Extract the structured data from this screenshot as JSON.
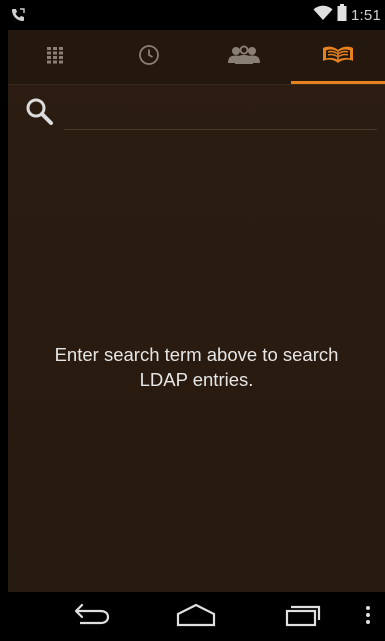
{
  "status_bar": {
    "time": "1:51",
    "left_icon": "phone-call-icon",
    "wifi_icon": "wifi-icon",
    "battery_icon": "battery-icon"
  },
  "tabs": [
    {
      "name": "tab-dialpad",
      "icon": "dialpad-icon",
      "active": false
    },
    {
      "name": "tab-recent",
      "icon": "clock-icon",
      "active": false
    },
    {
      "name": "tab-contacts",
      "icon": "contacts-icon",
      "active": false
    },
    {
      "name": "tab-ldap-directory",
      "icon": "book-icon",
      "active": true
    }
  ],
  "search": {
    "value": "",
    "placeholder": ""
  },
  "empty_state": {
    "line1": "Enter search term above to search",
    "line2": "LDAP entries."
  },
  "nav_bar": {
    "back_icon": "back-icon",
    "home_icon": "home-icon",
    "recents_icon": "recent-apps-icon",
    "menu_icon": "overflow-menu-icon"
  },
  "colors": {
    "accent": "#e8821e",
    "background": "#2a1b10",
    "icon_inactive": "#8a7f74",
    "text": "#e6e6e6"
  }
}
